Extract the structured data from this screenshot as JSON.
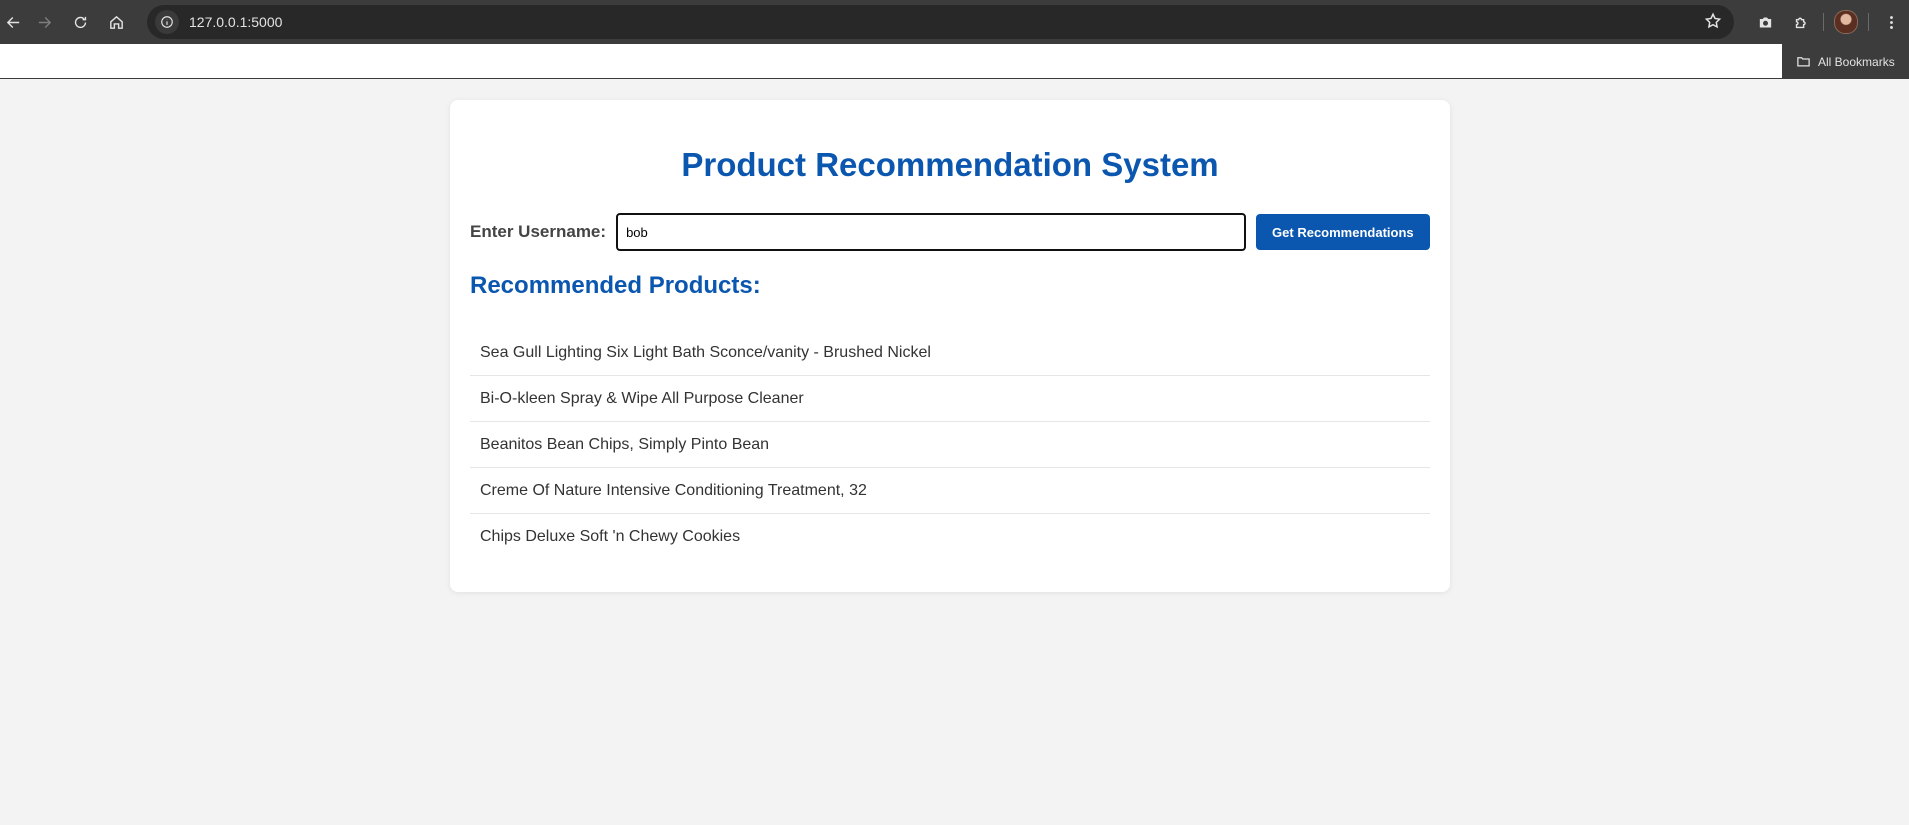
{
  "browser": {
    "url": "127.0.0.1:5000",
    "bookmarks_label": "All Bookmarks"
  },
  "page": {
    "title": "Product Recommendation System",
    "username_label": "Enter Username:",
    "username_value": "bob",
    "button_label": "Get Recommendations",
    "section_title": "Recommended Products:",
    "products": [
      "Sea Gull Lighting Six Light Bath Sconce/vanity - Brushed Nickel",
      "Bi-O-kleen Spray & Wipe All Purpose Cleaner",
      "Beanitos Bean Chips, Simply Pinto Bean",
      "Creme Of Nature Intensive Conditioning Treatment, 32",
      "Chips Deluxe Soft 'n Chewy Cookies"
    ]
  },
  "colors": {
    "accent": "#0b57b0",
    "page_background": "#f3f3f3",
    "card_background": "#ffffff",
    "browser_chrome": "#3c3c3c"
  },
  "icons": {
    "back": "arrow-left-icon",
    "forward": "arrow-right-icon",
    "reload": "reload-icon",
    "home": "home-icon",
    "site_info": "info-icon",
    "bookmark": "star-icon",
    "camera": "camera-icon",
    "extensions": "puzzle-icon",
    "profile": "avatar",
    "menu": "kebab-menu-icon",
    "bookmarks_folder": "folder-icon"
  }
}
